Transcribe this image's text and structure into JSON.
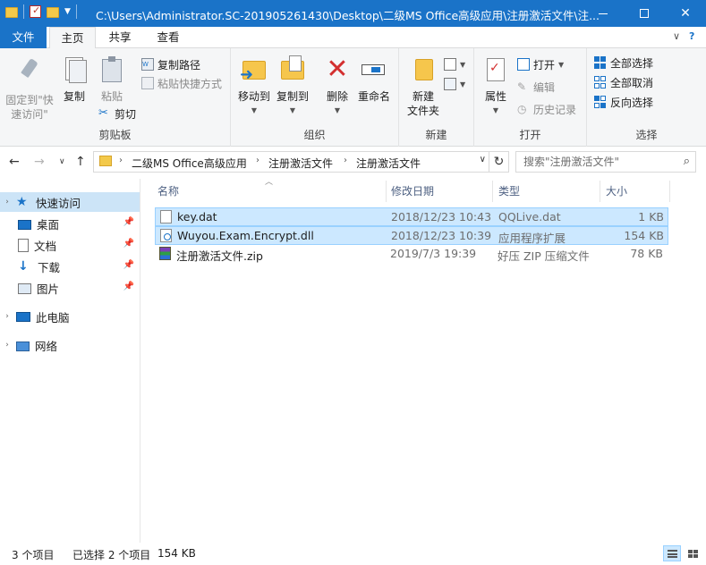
{
  "window": {
    "title": "C:\\Users\\Administrator.SC-201905261430\\Desktop\\二级MS Office高级应用\\注册激活文件\\注..."
  },
  "tabs": {
    "file": "文件",
    "home": "主页",
    "share": "共享",
    "view": "查看"
  },
  "ribbon": {
    "clipboard": {
      "label": "剪贴板",
      "pin_quick_access": "固定到\"快速访问\"",
      "copy": "复制",
      "paste": "粘贴",
      "copy_path": "复制路径",
      "paste_shortcut": "粘贴快捷方式",
      "cut": "剪切"
    },
    "organize": {
      "label": "组织",
      "move_to": "移动到",
      "copy_to": "复制到",
      "delete": "删除",
      "rename": "重命名"
    },
    "new": {
      "label": "新建",
      "new_folder": "新建\n文件夹"
    },
    "open": {
      "label": "打开",
      "properties": "属性",
      "open": "打开",
      "edit": "编辑",
      "history": "历史记录"
    },
    "select": {
      "label": "选择",
      "select_all": "全部选择",
      "select_none": "全部取消",
      "invert": "反向选择"
    }
  },
  "address": {
    "crumbs": [
      "二级MS Office高级应用",
      "注册激活文件",
      "注册激活文件"
    ],
    "search_placeholder": "搜索\"注册激活文件\""
  },
  "navpane": {
    "quick_access": "快速访问",
    "desktop": "桌面",
    "documents": "文档",
    "downloads": "下载",
    "pictures": "图片",
    "this_pc": "此电脑",
    "network": "网络"
  },
  "columns": {
    "name": "名称",
    "modified": "修改日期",
    "type": "类型",
    "size": "大小"
  },
  "files": [
    {
      "name": "key.dat",
      "modified": "2018/12/23 10:43",
      "type": "QQLive.dat",
      "size": "1 KB"
    },
    {
      "name": "Wuyou.Exam.Encrypt.dll",
      "modified": "2018/12/23 10:39",
      "type": "应用程序扩展",
      "size": "154 KB"
    },
    {
      "name": "注册激活文件.zip",
      "modified": "2019/7/3 19:39",
      "type": "好压 ZIP 压缩文件",
      "size": "78 KB"
    }
  ],
  "status": {
    "item_count": "3 个项目",
    "selected": "已选择 2 个项目",
    "selected_size": "154 KB"
  }
}
